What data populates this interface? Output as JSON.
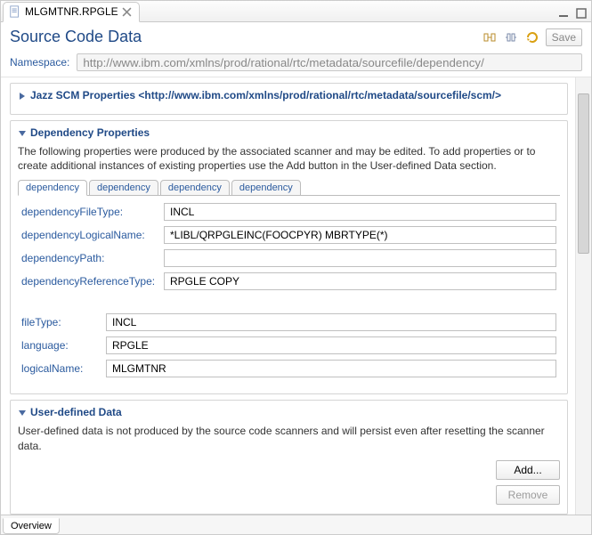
{
  "tab": {
    "filename": "MLGMTNR.RPGLE"
  },
  "page_title": "Source Code Data",
  "save_label": "Save",
  "namespace": {
    "label": "Namespace:",
    "value": "http://www.ibm.com/xmlns/prod/rational/rtc/metadata/sourcefile/dependency/"
  },
  "scm_section": {
    "title": "Jazz SCM Properties <http://www.ibm.com/xmlns/prod/rational/rtc/metadata/sourcefile/scm/>"
  },
  "dep_section": {
    "title": "Dependency Properties",
    "desc": "The following properties were produced by the associated scanner and may be edited.  To add properties or to create additional instances of existing properties use the Add button in the User-defined Data section.",
    "tabs": [
      "dependency",
      "dependency",
      "dependency",
      "dependency"
    ],
    "fields": {
      "dependencyFileType": {
        "label": "dependencyFileType:",
        "value": "INCL"
      },
      "dependencyLogicalName": {
        "label": "dependencyLogicalName:",
        "value": "*LIBL/QRPGLEINC(FOOCPYR) MBRTYPE(*)"
      },
      "dependencyPath": {
        "label": "dependencyPath:",
        "value": ""
      },
      "dependencyReferenceType": {
        "label": "dependencyReferenceType:",
        "value": "RPGLE COPY"
      }
    },
    "file_fields": {
      "fileType": {
        "label": "fileType:",
        "value": "INCL"
      },
      "language": {
        "label": "language:",
        "value": "RPGLE"
      },
      "logicalName": {
        "label": "logicalName:",
        "value": "MLGMTNR"
      }
    }
  },
  "userdef_section": {
    "title": "User-defined Data",
    "desc": "User-defined data is not produced by the source code scanners and will persist even after resetting the scanner data.",
    "add_label": "Add...",
    "remove_label": "Remove"
  },
  "bottom_tab": "Overview"
}
